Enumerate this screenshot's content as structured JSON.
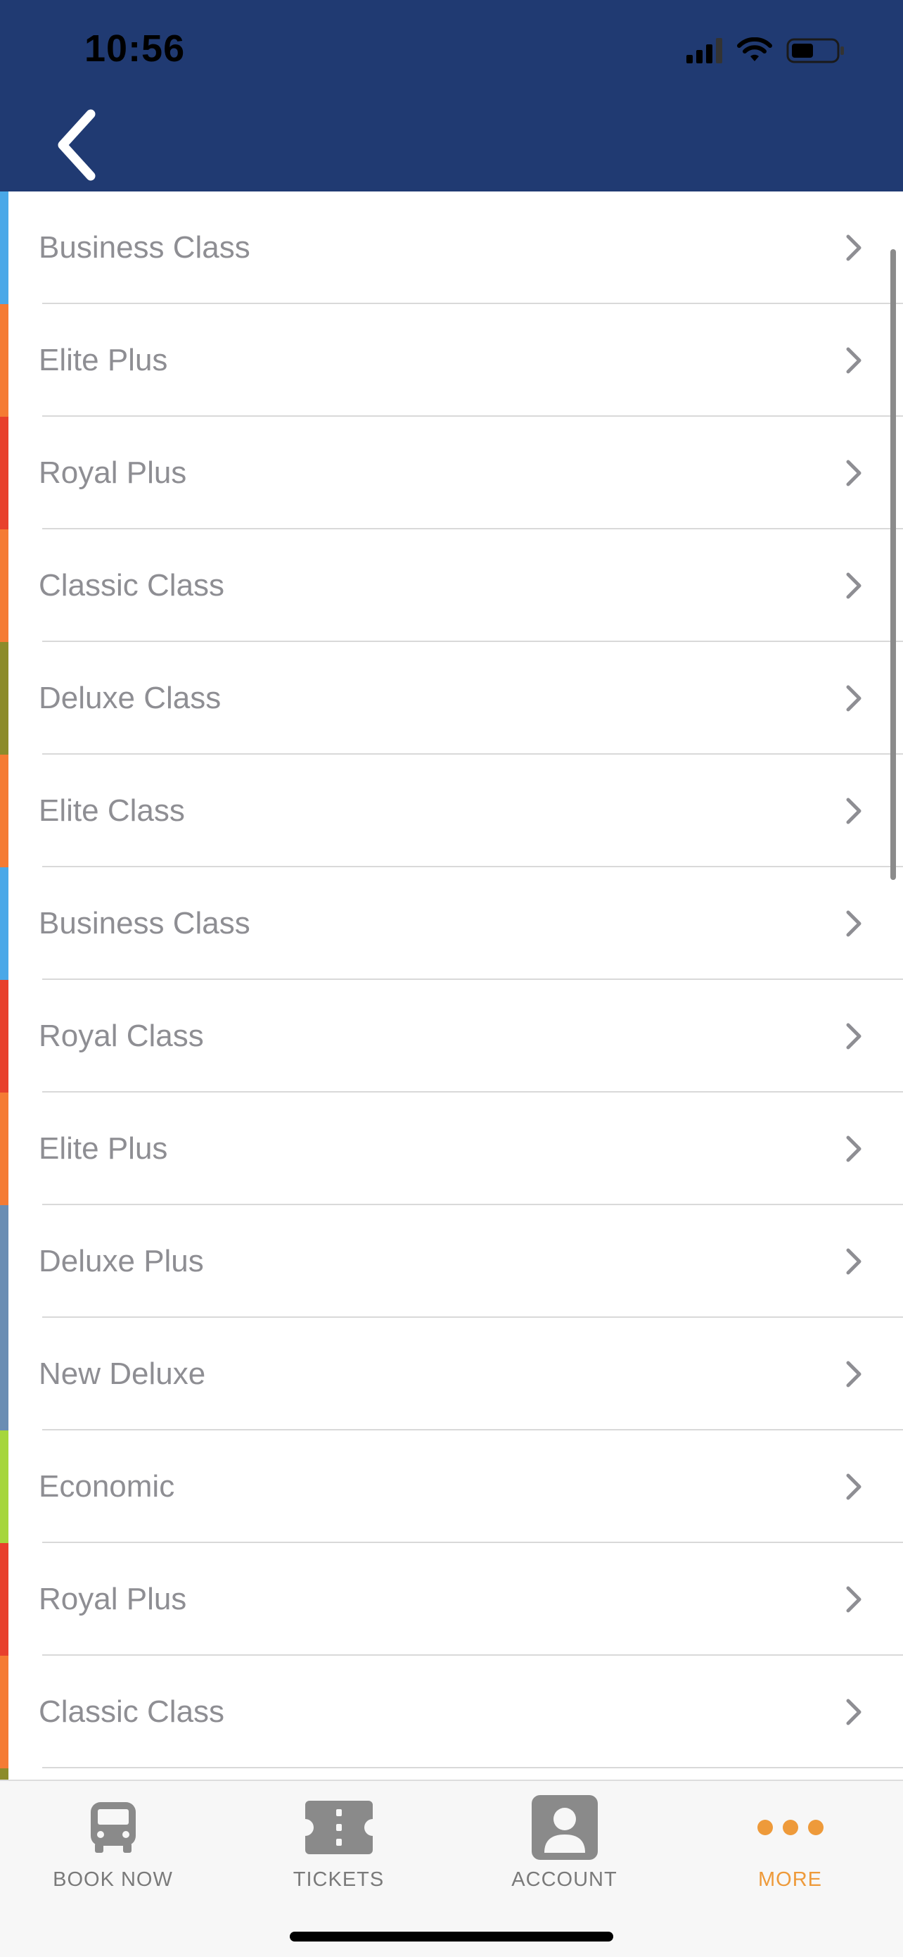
{
  "status_bar": {
    "time": "10:56"
  },
  "header": {
    "back_icon": "chevron-left-icon",
    "background_color": "#203a72"
  },
  "list": {
    "chevron_icon": "chevron-right-icon",
    "items": [
      {
        "label": "Business Class",
        "color": "#4aa8e8"
      },
      {
        "label": "Elite Plus",
        "color": "#f57b33"
      },
      {
        "label": "Royal Plus",
        "color": "#e8402c"
      },
      {
        "label": "Classic Class",
        "color": "#f57b33"
      },
      {
        "label": "Deluxe Class",
        "color": "#8c8b2a"
      },
      {
        "label": "Elite Class",
        "color": "#f57b33"
      },
      {
        "label": "Business Class",
        "color": "#4aa8e8"
      },
      {
        "label": "Royal Class",
        "color": "#e8402c"
      },
      {
        "label": "Elite Plus",
        "color": "#f57b33"
      },
      {
        "label": "Deluxe Plus",
        "color": "#6a8db3"
      },
      {
        "label": "New Deluxe",
        "color": "#6a8db3"
      },
      {
        "label": "Economic",
        "color": "#a6d63c"
      },
      {
        "label": "Royal Plus",
        "color": "#e8402c"
      },
      {
        "label": "Classic Class",
        "color": "#f57b33"
      },
      {
        "label": "",
        "color": "#8c8b2a"
      }
    ]
  },
  "tabbar": {
    "tabs": [
      {
        "label": "BOOK NOW",
        "icon": "bus-icon",
        "active": false
      },
      {
        "label": "TICKETS",
        "icon": "ticket-icon",
        "active": false
      },
      {
        "label": "ACCOUNT",
        "icon": "account-icon",
        "active": false
      },
      {
        "label": "MORE",
        "icon": "more-dots-icon",
        "active": true
      }
    ],
    "active_color": "#ee9a3a",
    "inactive_color": "#7a7a7a"
  }
}
